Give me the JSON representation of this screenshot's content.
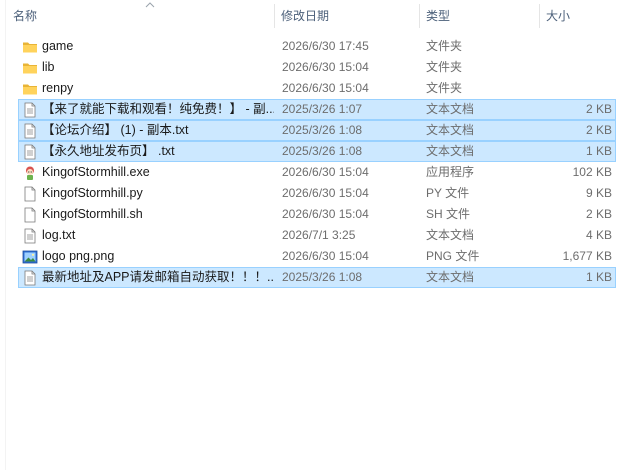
{
  "columns": {
    "name": "名称",
    "modified": "修改日期",
    "type": "类型",
    "size": "大小"
  },
  "files": [
    {
      "name": "game",
      "modified": "2026/6/30 17:45",
      "type": "文件夹",
      "size": "",
      "icon": "folder-icon",
      "selected": false
    },
    {
      "name": "lib",
      "modified": "2026/6/30 15:04",
      "type": "文件夹",
      "size": "",
      "icon": "folder-icon",
      "selected": false
    },
    {
      "name": "renpy",
      "modified": "2026/6/30 15:04",
      "type": "文件夹",
      "size": "",
      "icon": "folder-icon",
      "selected": false
    },
    {
      "name": "【来了就能下载和观看！纯免费！】 - 副...",
      "modified": "2025/3/26 1:07",
      "type": "文本文档",
      "size": "2 KB",
      "icon": "text-document-icon",
      "selected": true
    },
    {
      "name": "【论坛介绍】 (1) - 副本.txt",
      "modified": "2025/3/26 1:08",
      "type": "文本文档",
      "size": "2 KB",
      "icon": "text-document-icon",
      "selected": true
    },
    {
      "name": "【永久地址发布页】 .txt",
      "modified": "2025/3/26 1:08",
      "type": "文本文档",
      "size": "1 KB",
      "icon": "text-document-icon",
      "selected": true
    },
    {
      "name": "KingofStormhill.exe",
      "modified": "2026/6/30 15:04",
      "type": "应用程序",
      "size": "102 KB",
      "icon": "renpy-app-icon",
      "selected": false
    },
    {
      "name": "KingofStormhill.py",
      "modified": "2026/6/30 15:04",
      "type": "PY 文件",
      "size": "9 KB",
      "icon": "blank-file-icon",
      "selected": false
    },
    {
      "name": "KingofStormhill.sh",
      "modified": "2026/6/30 15:04",
      "type": "SH 文件",
      "size": "2 KB",
      "icon": "blank-file-icon",
      "selected": false
    },
    {
      "name": "log.txt",
      "modified": "2026/7/1 3:25",
      "type": "文本文档",
      "size": "4 KB",
      "icon": "text-document-icon",
      "selected": false
    },
    {
      "name": "logo png.png",
      "modified": "2026/6/30 15:04",
      "type": "PNG 文件",
      "size": "1,677 KB",
      "icon": "image-file-icon",
      "selected": false
    },
    {
      "name": "最新地址及APP请发邮箱自动获取！！！...",
      "modified": "2025/3/26 1:08",
      "type": "文本文档",
      "size": "1 KB",
      "icon": "text-document-icon",
      "selected": true
    }
  ]
}
